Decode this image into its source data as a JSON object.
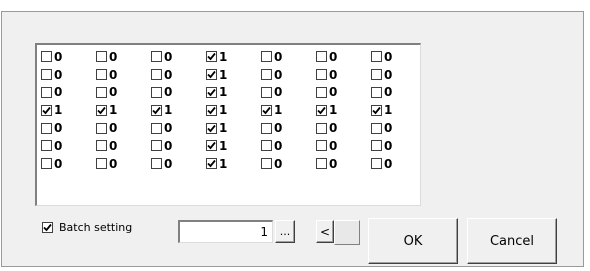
{
  "grid": {
    "rows": [
      [
        {
          "checked": false,
          "label": "0"
        },
        {
          "checked": false,
          "label": "0"
        },
        {
          "checked": false,
          "label": "0"
        },
        {
          "checked": true,
          "label": "1"
        },
        {
          "checked": false,
          "label": "0"
        },
        {
          "checked": false,
          "label": "0"
        },
        {
          "checked": false,
          "label": "0"
        }
      ],
      [
        {
          "checked": false,
          "label": "0"
        },
        {
          "checked": false,
          "label": "0"
        },
        {
          "checked": false,
          "label": "0"
        },
        {
          "checked": true,
          "label": "1"
        },
        {
          "checked": false,
          "label": "0"
        },
        {
          "checked": false,
          "label": "0"
        },
        {
          "checked": false,
          "label": "0"
        }
      ],
      [
        {
          "checked": false,
          "label": "0"
        },
        {
          "checked": false,
          "label": "0"
        },
        {
          "checked": false,
          "label": "0"
        },
        {
          "checked": true,
          "label": "1"
        },
        {
          "checked": false,
          "label": "0"
        },
        {
          "checked": false,
          "label": "0"
        },
        {
          "checked": false,
          "label": "0"
        }
      ],
      [
        {
          "checked": true,
          "label": "1"
        },
        {
          "checked": true,
          "label": "1"
        },
        {
          "checked": true,
          "label": "1"
        },
        {
          "checked": true,
          "label": "1"
        },
        {
          "checked": true,
          "label": "1"
        },
        {
          "checked": true,
          "label": "1"
        },
        {
          "checked": true,
          "label": "1"
        }
      ],
      [
        {
          "checked": false,
          "label": "0"
        },
        {
          "checked": false,
          "label": "0"
        },
        {
          "checked": false,
          "label": "0"
        },
        {
          "checked": true,
          "label": "1"
        },
        {
          "checked": false,
          "label": "0"
        },
        {
          "checked": false,
          "label": "0"
        },
        {
          "checked": false,
          "label": "0"
        }
      ],
      [
        {
          "checked": false,
          "label": "0"
        },
        {
          "checked": false,
          "label": "0"
        },
        {
          "checked": false,
          "label": "0"
        },
        {
          "checked": true,
          "label": "1"
        },
        {
          "checked": false,
          "label": "0"
        },
        {
          "checked": false,
          "label": "0"
        },
        {
          "checked": false,
          "label": "0"
        }
      ],
      [
        {
          "checked": false,
          "label": "0"
        },
        {
          "checked": false,
          "label": "0"
        },
        {
          "checked": false,
          "label": "0"
        },
        {
          "checked": true,
          "label": "1"
        },
        {
          "checked": false,
          "label": "0"
        },
        {
          "checked": false,
          "label": "0"
        },
        {
          "checked": false,
          "label": "0"
        }
      ]
    ]
  },
  "batch": {
    "label": "Batch setting",
    "checked": true
  },
  "value_input": {
    "value": "1"
  },
  "buttons": {
    "ellipsis": "...",
    "prev": "<",
    "ok": "OK",
    "cancel": "Cancel"
  },
  "icons": {
    "check": "checkmark-icon"
  }
}
